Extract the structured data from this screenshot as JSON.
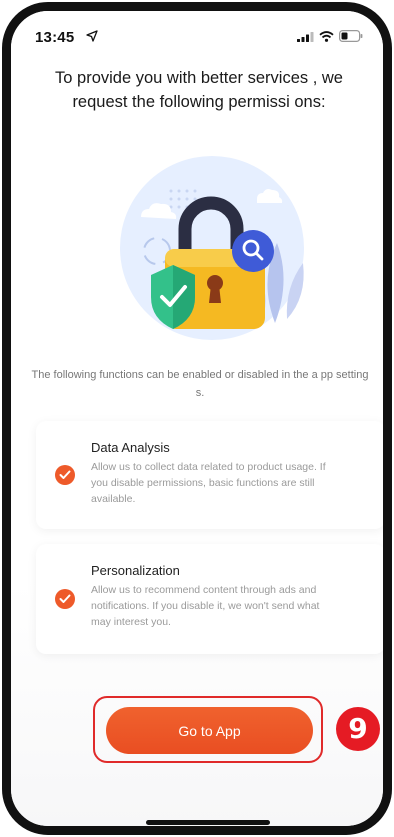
{
  "status_bar": {
    "time": "13:45",
    "icons": [
      "location-arrow-icon",
      "signal-icon",
      "wifi-icon",
      "battery-icon"
    ]
  },
  "headline": "To provide you with better services , we request the following permissi ons:",
  "illustration": {
    "icons": [
      "padlock-icon",
      "shield-check-icon",
      "search-icon"
    ]
  },
  "settings_note": "The following functions can be enabled or disabled in the a pp settings.",
  "permissions": [
    {
      "title": "Data Analysis",
      "description": "Allow us to collect data related to product usage. If you disable permissions, basic functions are still available.",
      "checked": true
    },
    {
      "title": "Personalization",
      "description": "Allow us to recommend content through ads and notifications. If you disable it, we won't send what may interest you.",
      "checked": true
    }
  ],
  "cta": {
    "label": "Go to App"
  },
  "step_badge": "9",
  "colors": {
    "accent": "#ee5a2a",
    "highlight_border": "#e02a2a",
    "badge": "#e51b24"
  }
}
